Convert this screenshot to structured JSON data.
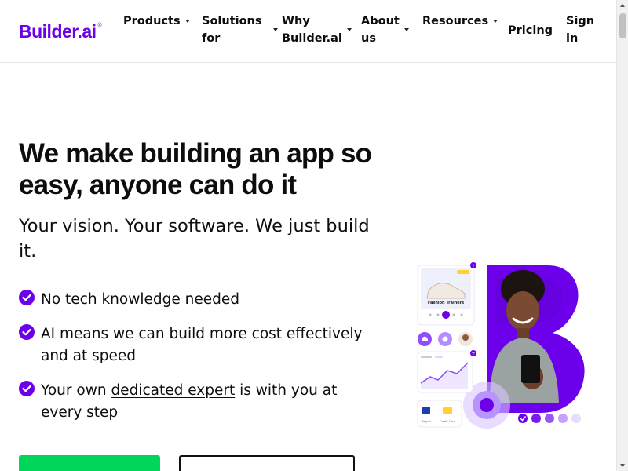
{
  "brand": {
    "name": "Builder.ai",
    "reg": "®",
    "color": "#6c00ea"
  },
  "nav": {
    "products": "Products",
    "solutions_line1": "Solutions",
    "solutions_line2": "for",
    "why_line1": "Why",
    "why_line2": "Builder.ai",
    "about_line1": "About",
    "about_line2": "us",
    "resources": "Resources",
    "pricing": "Pricing",
    "signin_line1": "Sign",
    "signin_line2": "in"
  },
  "hero": {
    "title": "We make building an app so easy, anyone can do it",
    "subtitle": "Your vision. Your software. We just build it."
  },
  "features": [
    {
      "text": "No tech knowledge needed"
    },
    {
      "link": "AI means we can build more cost effectively",
      "after": " and at speed"
    },
    {
      "before": "Your own ",
      "link": "dedicated expert",
      "after": " is with you at every step"
    }
  ],
  "illustration": {
    "product_name": "Fashion Trainers",
    "pay_labels": [
      "Paypal",
      "Credit Card"
    ]
  },
  "colors": {
    "primary_cta": "#00d659",
    "accent": "#6c00ea",
    "text": "#0d0d0d"
  },
  "icons": [
    "check-circle-icon",
    "caret-down-icon",
    "bell-icon",
    "gear-icon",
    "paypal-icon",
    "card-icon"
  ]
}
